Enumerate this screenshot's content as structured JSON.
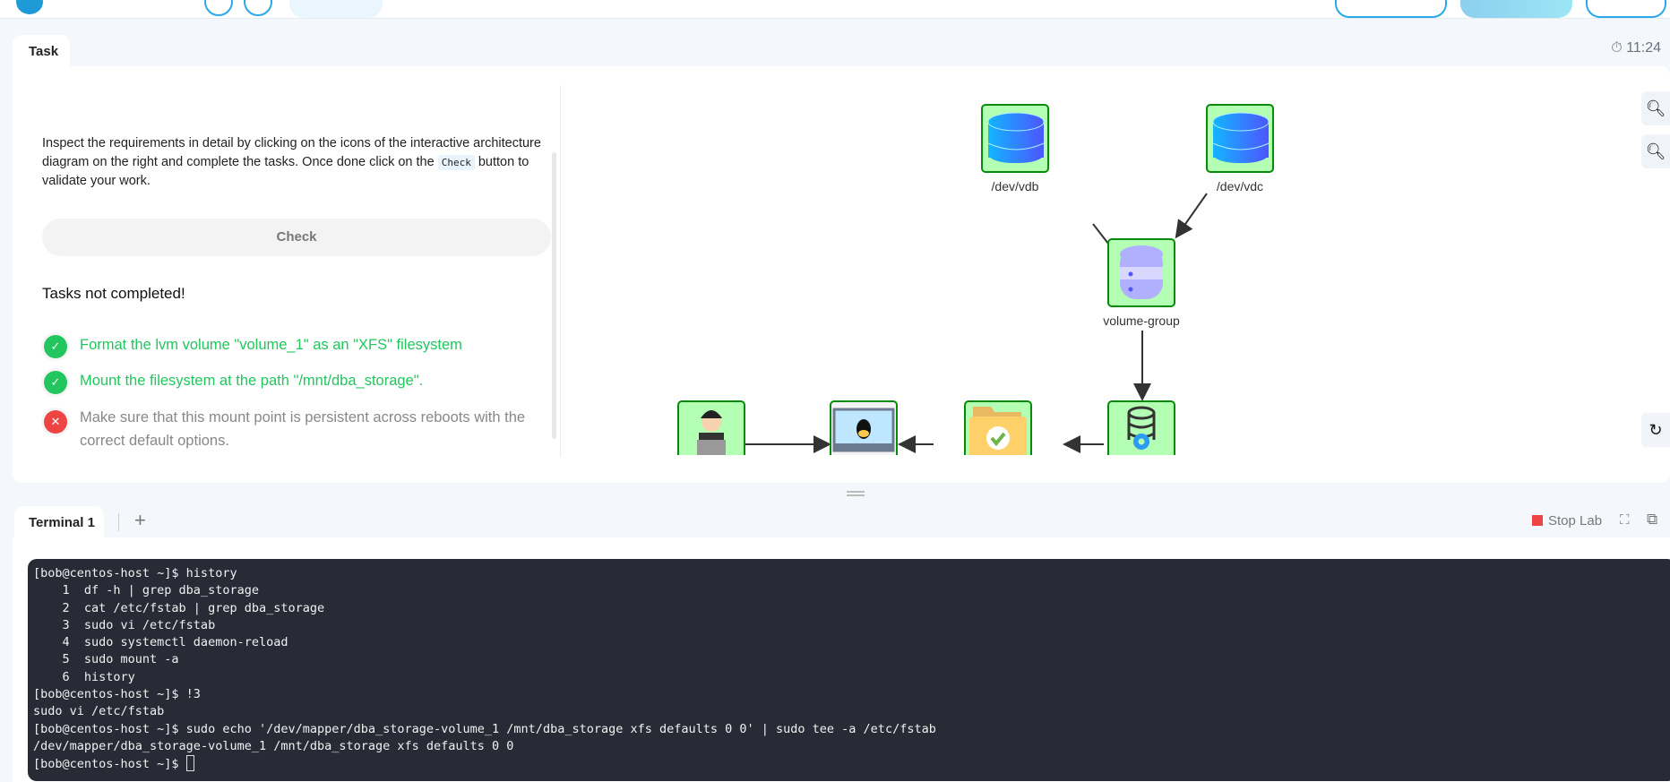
{
  "task_tab": {
    "label": "Task",
    "timer": "11:24"
  },
  "instructions": {
    "before": "Inspect the requirements in detail by clicking on the icons of the interactive architecture diagram on the right and complete the tasks. Once done click on the ",
    "code": "Check",
    "after": " button to validate your work."
  },
  "check_button": "Check",
  "status": "Tasks not completed!",
  "tasks": [
    {
      "text": "Format the lvm volume \"volume_1\" as an \"XFS\" filesystem",
      "done": true
    },
    {
      "text": "Mount the filesystem at the path \"/mnt/dba_storage\".",
      "done": true
    },
    {
      "text": "Make sure that this mount point is persistent across reboots with the correct default options.",
      "done": false
    }
  ],
  "diagram": {
    "vdb": "/dev/vdb",
    "vdc": "/dev/vdc",
    "vg": "volume-group"
  },
  "terminal": {
    "tab": "Terminal 1",
    "add": "+",
    "stop": "Stop Lab",
    "lines": [
      "[bob@centos-host ~]$ history",
      "    1  df -h | grep dba_storage",
      "    2  cat /etc/fstab | grep dba_storage",
      "    3  sudo vi /etc/fstab",
      "    4  sudo systemctl daemon-reload",
      "    5  sudo mount -a",
      "    6  history",
      "[bob@centos-host ~]$ !3",
      "sudo vi /etc/fstab",
      "[bob@centos-host ~]$ sudo echo '/dev/mapper/dba_storage-volume_1 /mnt/dba_storage xfs defaults 0 0' | sudo tee -a /etc/fstab",
      "/dev/mapper/dba_storage-volume_1 /mnt/dba_storage xfs defaults 0 0",
      "[bob@centos-host ~]$ "
    ]
  },
  "colors": {
    "success": "#22c55e",
    "error": "#ef4444",
    "node_fill": "#b3ffb3",
    "node_border": "#0a8a0a",
    "terminal_bg": "#282a36"
  }
}
